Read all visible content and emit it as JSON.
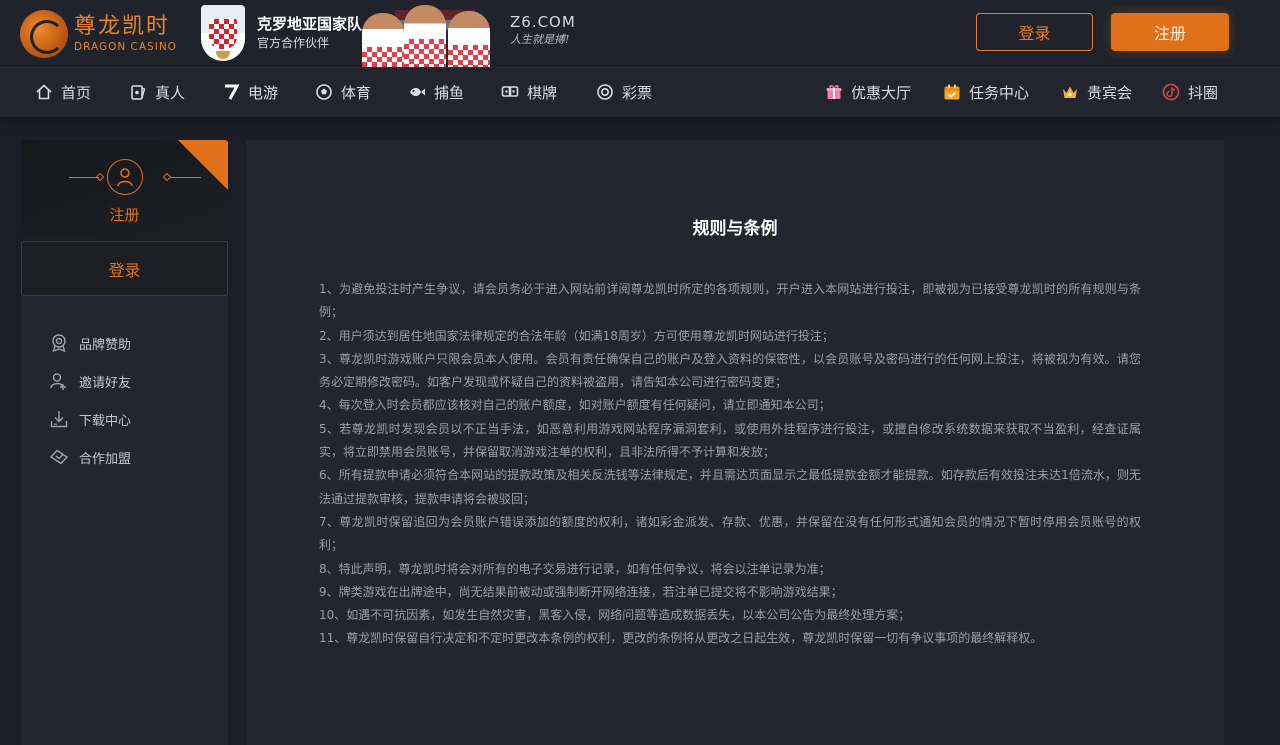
{
  "header": {
    "logo_cn": "尊龙凯时",
    "logo_en": "DRAGON CASINO",
    "partner_title": "克罗地亚国家队",
    "partner_sub": "官方合作伙伴",
    "domain": "Z6.COM",
    "slogan": "人生就是搏!",
    "login_label": "登录",
    "register_label": "注册",
    "accent_color": "#e0711a"
  },
  "nav": {
    "left": [
      {
        "label": "首页",
        "icon": "home-icon"
      },
      {
        "label": "真人",
        "icon": "cards-icon"
      },
      {
        "label": "电游",
        "icon": "slot-seven-icon"
      },
      {
        "label": "体育",
        "icon": "soccer-ball-icon"
      },
      {
        "label": "捕鱼",
        "icon": "fish-icon"
      },
      {
        "label": "棋牌",
        "icon": "dice-icon"
      },
      {
        "label": "彩票",
        "icon": "lottery-ball-icon"
      }
    ],
    "right": [
      {
        "label": "优惠大厅",
        "icon": "gift-icon"
      },
      {
        "label": "任务中心",
        "icon": "calendar-icon"
      },
      {
        "label": "贵宾会",
        "icon": "crown-icon"
      },
      {
        "label": "抖圈",
        "icon": "tiktok-icon"
      }
    ]
  },
  "sidebar": {
    "register_label": "注册",
    "login_label": "登录",
    "items": [
      {
        "label": "品牌赞助",
        "icon": "award-badge-icon"
      },
      {
        "label": "邀请好友",
        "icon": "invite-user-icon"
      },
      {
        "label": "下载中心",
        "icon": "download-icon"
      },
      {
        "label": "合作加盟",
        "icon": "handshake-icon"
      }
    ]
  },
  "content": {
    "title": "规则与条例",
    "rules": [
      "1、为避免投注时产生争议，请会员务必于进入网站前详阅尊龙凯时所定的各项规则，开户进入本网站进行投注，即被视为已接受尊龙凯时的所有规则与条例；",
      "2、用户须达到居住地国家法律规定的合法年龄（如满18周岁）方可使用尊龙凯时网站进行投注；",
      "3、尊龙凯时游戏账户只限会员本人使用。会员有责任确保自己的账户及登入资料的保密性，以会员账号及密码进行的任何网上投注，将被视为有效。请您务必定期修改密码。如客户发现或怀疑自己的资料被盗用，请告知本公司进行密码变更；",
      "4、每次登入时会员都应该核对自己的账户额度，如对账户额度有任何疑问，请立即通知本公司；",
      "5、若尊龙凯时发现会员以不正当手法，如恶意利用游戏网站程序漏洞套利，或使用外挂程序进行投注，或擅自修改系统数据来获取不当盈利，经查证属实，将立即禁用会员账号，并保留取消游戏注单的权利，且非法所得不予计算和发放；",
      "6、所有提款申请必须符合本网站的提款政策及相关反洗钱等法律规定，并且需达页面显示之最低提款金额才能提款。如存款后有效投注未达1倍流水，则无法通过提款审核，提款申请将会被驳回；",
      "7、尊龙凯时保留追回为会员账户错误添加的额度的权利，诸如彩金派发、存款、优惠，并保留在没有任何形式通知会员的情况下暂时停用会员账号的权利；",
      "8、特此声明，尊龙凯时将会对所有的电子交易进行记录，如有任何争议，将会以注单记录为准；",
      "9、牌类游戏在出牌途中，尚无结果前被动或强制断开网络连接，若注单已提交将不影响游戏结果；",
      "10、如遇不可抗因素，如发生自然灾害，黑客入侵，网络问题等造成数据丢失，以本公司公告为最终处理方案；",
      "11、尊龙凯时保留自行决定和不定时更改本条例的权利，更改的条例将从更改之日起生效，尊龙凯时保留一切有争议事项的最终解释权。"
    ]
  }
}
